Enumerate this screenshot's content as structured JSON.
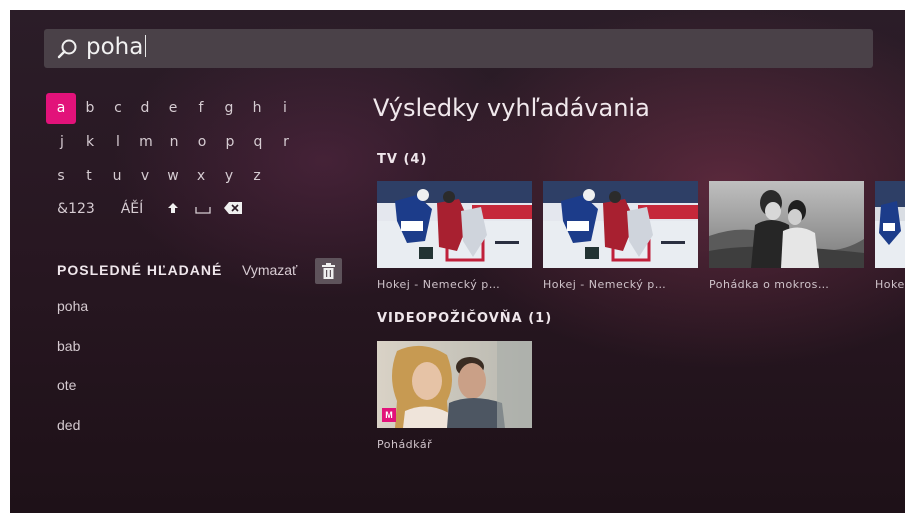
{
  "search": {
    "query": "poha"
  },
  "keyboard": {
    "rows": [
      [
        "a",
        "b",
        "c",
        "d",
        "e",
        "f",
        "g",
        "h",
        "i"
      ],
      [
        "j",
        "k",
        "l",
        "m",
        "n",
        "o",
        "p",
        "q",
        "r"
      ],
      [
        "s",
        "t",
        "u",
        "v",
        "w",
        "x",
        "y",
        "z"
      ]
    ],
    "special": {
      "numbers": "&123",
      "accents": "ÁĚÍ",
      "shift": "🡅",
      "space": "⎵",
      "backspace": "⌫"
    },
    "selected": "a"
  },
  "recent": {
    "title": "POSLEDNÉ HĽADANÉ",
    "clear_label": "Vymazať",
    "items": [
      "poha",
      "bab",
      "ote",
      "ded"
    ]
  },
  "results": {
    "title": "Výsledky vyhľadávania",
    "tv": {
      "title": "TV (4)",
      "items": [
        {
          "caption": "Hokej - Nemecký p…",
          "icon": "hockey-image"
        },
        {
          "caption": "Hokej - Nemecký p…",
          "icon": "hockey-image"
        },
        {
          "caption": "Pohádka o mokros…",
          "icon": "film-still-image"
        },
        {
          "caption": "Hoke",
          "icon": "hockey-image"
        }
      ]
    },
    "vod": {
      "title": "VIDEOPOŽIČOVŇA (1)",
      "items": [
        {
          "caption": "Pohádkář",
          "badge": "M",
          "icon": "movie-poster-image"
        }
      ]
    }
  },
  "colors": {
    "accent": "#e2127a",
    "searchbar": "#4a4148"
  }
}
